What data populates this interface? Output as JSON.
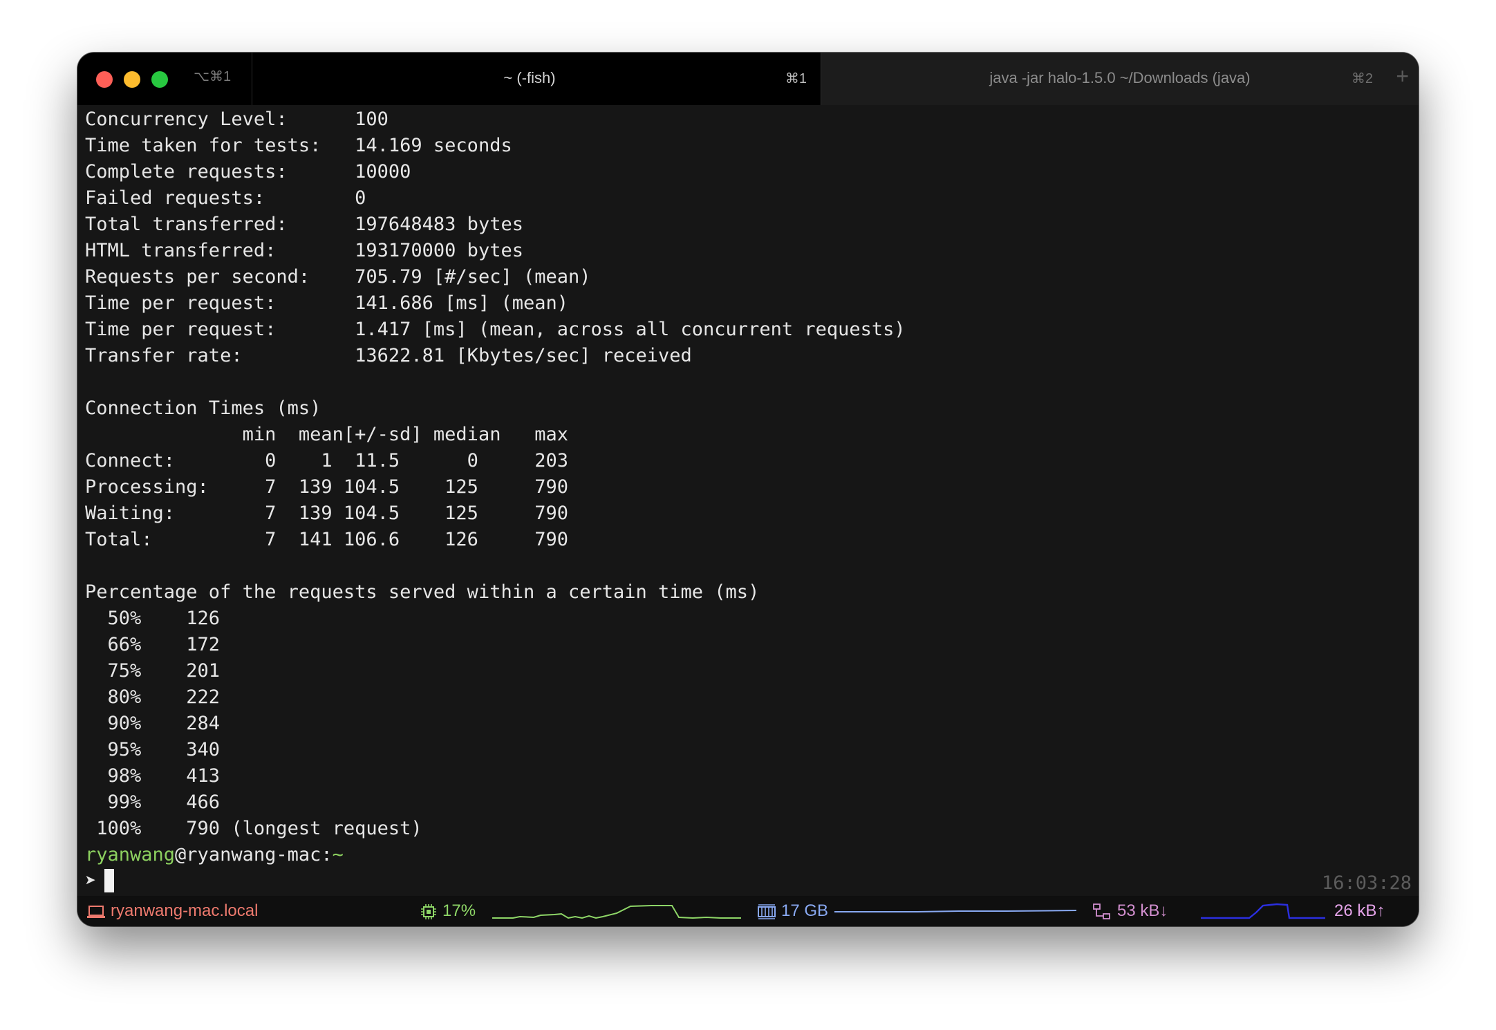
{
  "window": {
    "left_shortcut": "⌥⌘1",
    "tabs": [
      {
        "title": "~ (-fish)",
        "shortcut": "⌘1",
        "active": true
      },
      {
        "title": "java -jar halo-1.5.0 ~/Downloads (java)",
        "shortcut": "⌘2",
        "active": false
      }
    ],
    "add_tab_label": "+"
  },
  "terminal": {
    "lines": [
      "Concurrency Level:      100",
      "Time taken for tests:   14.169 seconds",
      "Complete requests:      10000",
      "Failed requests:        0",
      "Total transferred:      197648483 bytes",
      "HTML transferred:       193170000 bytes",
      "Requests per second:    705.79 [#/sec] (mean)",
      "Time per request:       141.686 [ms] (mean)",
      "Time per request:       1.417 [ms] (mean, across all concurrent requests)",
      "Transfer rate:          13622.81 [Kbytes/sec] received",
      "",
      "Connection Times (ms)",
      "              min  mean[+/-sd] median   max",
      "Connect:        0    1  11.5      0     203",
      "Processing:     7  139 104.5    125     790",
      "Waiting:        7  139 104.5    125     790",
      "Total:          7  141 106.6    126     790",
      "",
      "Percentage of the requests served within a certain time (ms)",
      "  50%    126",
      "  66%    172",
      "  75%    201",
      "  80%    222",
      "  90%    284",
      "  95%    340",
      "  98%    413",
      "  99%    466",
      " 100%    790 (longest request)"
    ],
    "prompt": {
      "user": "ryanwang",
      "at_host": "@ryanwang-mac:",
      "path": "~",
      "arrow": "➤"
    },
    "clock": "16:03:28"
  },
  "statusbar": {
    "hostname": "ryanwang-mac.local",
    "cpu": "17%",
    "memory": "17 GB",
    "net_down": "53 kB↓",
    "net_up": "26 kB↑",
    "colors": {
      "host": "#ee7a6e",
      "cpu": "#8ed667",
      "memory": "#89a9f2",
      "net": "#d28fcf",
      "up_graph": "#2b2fe0"
    }
  }
}
